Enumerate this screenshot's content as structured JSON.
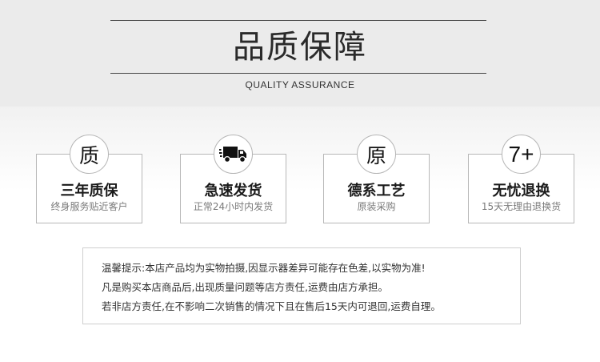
{
  "header": {
    "title": "品质保障",
    "subtitle": "QUALITY ASSURANCE"
  },
  "features": [
    {
      "icon": "quality-character-icon",
      "glyph": "质",
      "name": "三年质保",
      "desc": "终身服务贴近客户"
    },
    {
      "icon": "delivery-truck-icon",
      "glyph": "",
      "name": "急速发货",
      "desc": "正常24小时内发货"
    },
    {
      "icon": "original-character-icon",
      "glyph": "原",
      "name": "德系工艺",
      "desc": "原装采购"
    },
    {
      "icon": "seven-plus-icon",
      "glyph": "7+",
      "name": "无忧退换",
      "desc": "15天无理由退换货"
    }
  ],
  "notice": {
    "lines": [
      "温馨提示:本店产品均为实物拍摄,因显示器差异可能存在色差,以实物为准!",
      "凡是购买本店商品后,出现质量问题等店方责任,运费由店方承担。",
      "若非店方责任,在不影响二次销售的情况下且在售后15天内可退回,运费自理。"
    ]
  }
}
